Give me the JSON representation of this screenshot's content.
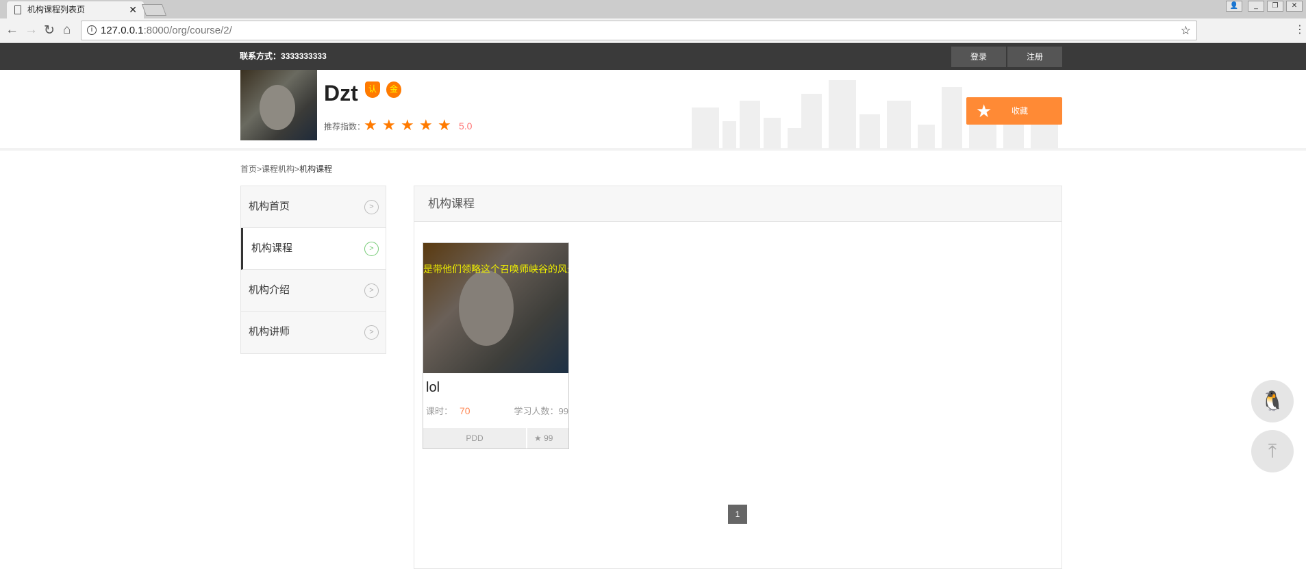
{
  "browser": {
    "tab_title": "机构课程列表页",
    "url_host": "127.0.0.1",
    "url_rest": ":8000/org/course/2/"
  },
  "topbar": {
    "contact_label": "联系方式：",
    "contact_value": "3333333333",
    "login": "登录",
    "register": "注册"
  },
  "org": {
    "name": "Dzt",
    "badge_certified": "认",
    "badge_gold": "金",
    "rating_label": "推荐指数：",
    "rating": 5,
    "rating_text": "5.0",
    "favorite": "收藏"
  },
  "breadcrumb": [
    "首页",
    ">",
    "课程机构",
    ">",
    "机构课程"
  ],
  "sidebar": {
    "items": [
      {
        "label": "机构首页"
      },
      {
        "label": "机构课程"
      },
      {
        "label": "机构介绍"
      },
      {
        "label": "机构讲师"
      }
    ]
  },
  "main": {
    "title": "机构课程",
    "courses": [
      {
        "caption": "是带他们领略这个召唤师峡谷的风光",
        "name": "lol",
        "hours_label": "课时：",
        "hours": "70",
        "students_label": "学习人数：",
        "students": "99",
        "teacher": "PDD",
        "favorites": "99"
      }
    ],
    "pages": [
      "1"
    ]
  },
  "colors": {
    "accent": "#ff7a00",
    "topbar": "#3a3a3a"
  }
}
